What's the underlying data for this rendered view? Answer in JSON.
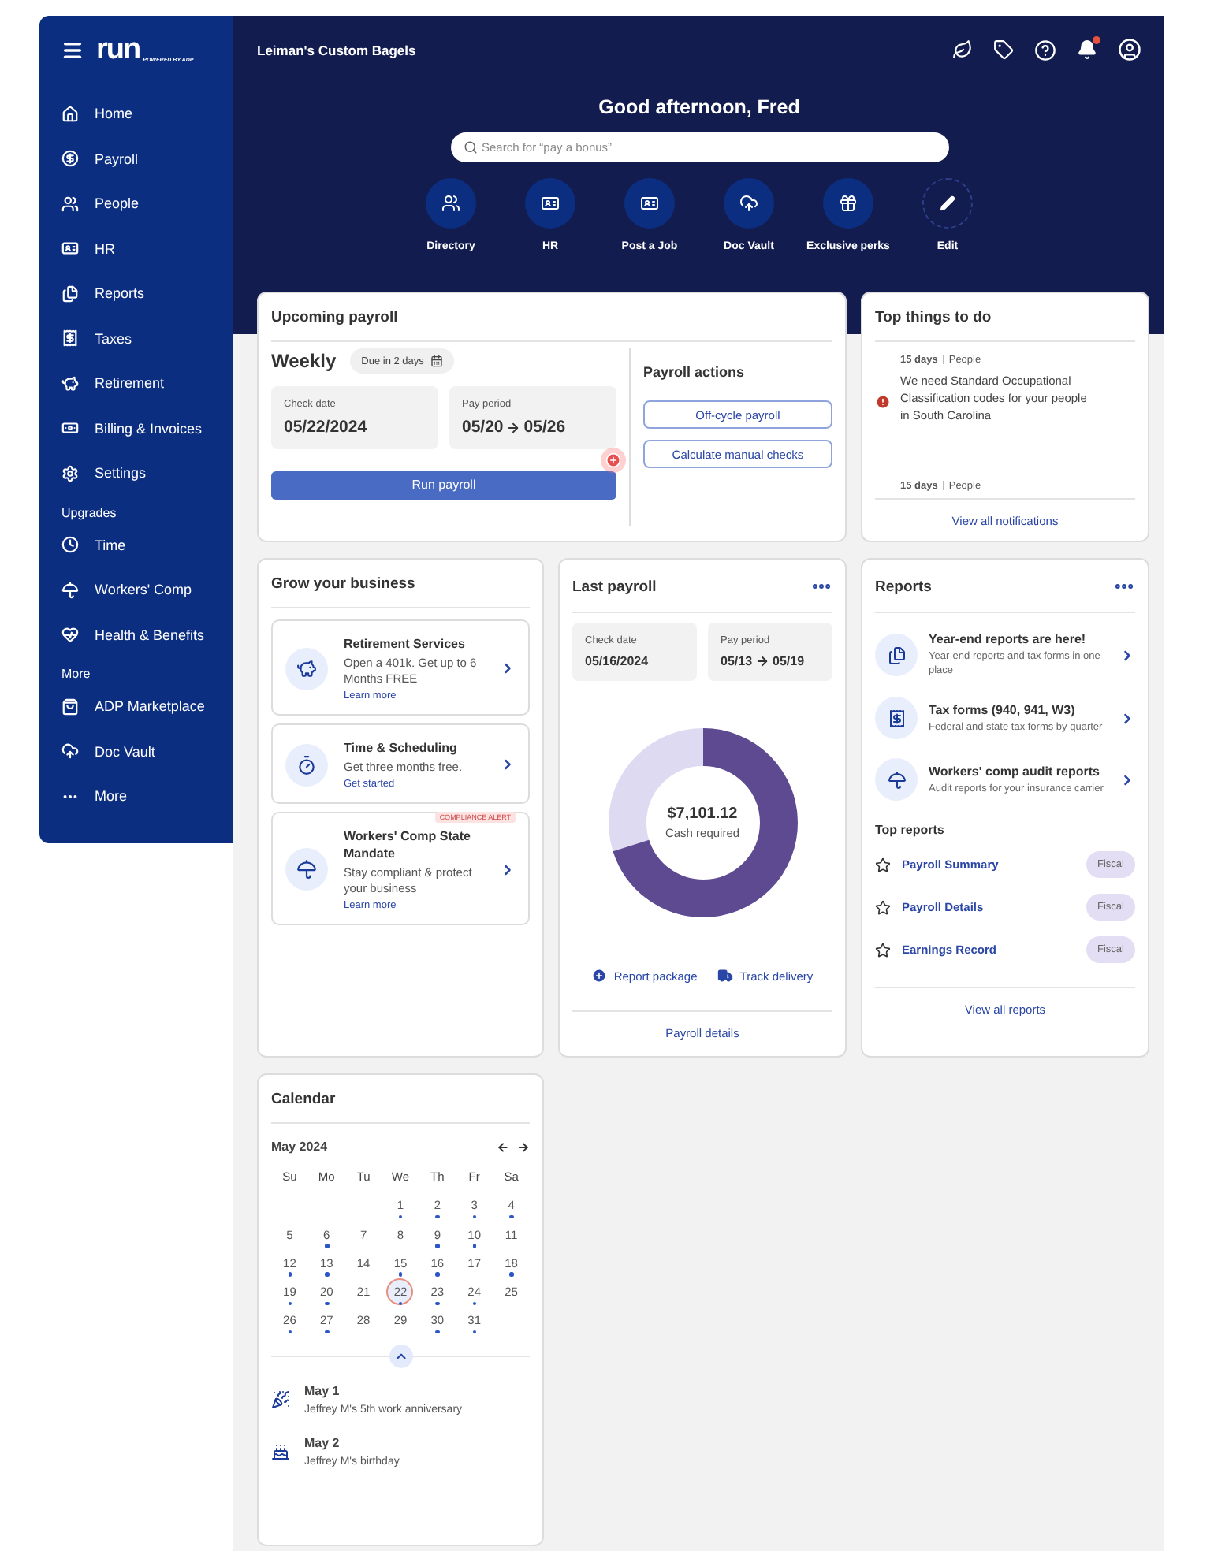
{
  "sidebar": {
    "logo": {
      "name": "run",
      "tagline": "POWERED BY ADP"
    },
    "sections": [
      {
        "items": [
          {
            "label": "Home"
          },
          {
            "label": "Payroll"
          },
          {
            "label": "People"
          },
          {
            "label": "HR"
          },
          {
            "label": "Reports"
          },
          {
            "label": "Taxes"
          },
          {
            "label": "Retirement"
          },
          {
            "label": "Billing & Invoices"
          },
          {
            "label": "Settings"
          }
        ]
      },
      {
        "heading": "Upgrades",
        "items": [
          {
            "label": "Time"
          },
          {
            "label": "Workers' Comp"
          },
          {
            "label": "Health & Benefits"
          }
        ]
      },
      {
        "heading": "More",
        "items": [
          {
            "label": "ADP Marketplace"
          },
          {
            "label": "Doc Vault"
          },
          {
            "label": "More"
          }
        ]
      }
    ]
  },
  "header": {
    "company": "Leiman's Custom Bagels",
    "bell_badge": true,
    "greeting": "Good afternoon, Fred",
    "search": {
      "placeholder": "Search for “pay a bonus”"
    },
    "quick_actions": [
      {
        "label": "Directory",
        "kind": "shortcut"
      },
      {
        "label": "HR",
        "kind": "shortcut"
      },
      {
        "label": "Post a Job",
        "kind": "shortcut"
      },
      {
        "label": "Doc Vault",
        "kind": "shortcut"
      },
      {
        "label": "Exclusive perks",
        "kind": "shortcut"
      },
      {
        "label": "Edit",
        "kind": "edit"
      }
    ]
  },
  "upcoming_payroll": {
    "title": "Upcoming payroll",
    "frequency": "Weekly",
    "due": "Due in 2 days",
    "check_date": {
      "label": "Check date",
      "value": "05/22/2024"
    },
    "pay_period": {
      "label": "Pay period",
      "start": "05/20",
      "end": "05/26"
    },
    "run_button": "Run payroll",
    "add_badge": true,
    "actions_title": "Payroll actions",
    "actions": [
      "Off-cycle payroll",
      "Calculate manual checks"
    ]
  },
  "top_things": {
    "title": "Top things to do",
    "items": [
      {
        "days": "15 days",
        "category": "People",
        "message": "We need Standard Occupational Classification codes for your people in South Carolina",
        "urgent": true
      },
      {
        "days": "15 days",
        "category": "People",
        "urgent": false
      }
    ],
    "link": "View all notifications"
  },
  "grow": {
    "title": "Grow your business",
    "offers": [
      {
        "title": "Retirement Services",
        "text": "Open a 401k. Get up to 6 Months FREE",
        "link": "Learn more"
      },
      {
        "title": "Time & Scheduling",
        "text": "Get three months free.",
        "link": "Get started"
      },
      {
        "title": "Workers' Comp State Mandate",
        "text": "Stay compliant & protect your business",
        "link": "Learn more",
        "badge": "COMPLIANCE ALERT"
      }
    ]
  },
  "last_payroll": {
    "title": "Last payroll",
    "check_date": {
      "label": "Check date",
      "value": "05/16/2024"
    },
    "pay_period": {
      "label": "Pay period",
      "start": "05/13",
      "end": "05/19"
    },
    "amount": "$7,101.12",
    "amount_label": "Cash required",
    "links": [
      "Report package",
      "Track delivery"
    ],
    "footer_link": "Payroll details"
  },
  "reports": {
    "title": "Reports",
    "features": [
      {
        "title": "Year-end reports are here!",
        "text": "Year-end reports and tax forms in one place"
      },
      {
        "title": "Tax forms (940, 941, W3)",
        "text": "Federal and state tax forms by quarter"
      },
      {
        "title": "Workers' comp audit reports",
        "text": "Audit reports for your insurance carrier"
      }
    ],
    "top_title": "Top reports",
    "top": [
      {
        "name": "Payroll Summary",
        "tag": "Fiscal",
        "starred": false
      },
      {
        "name": "Payroll Details",
        "tag": "Fiscal",
        "starred": false
      },
      {
        "name": "Earnings Record",
        "tag": "Fiscal",
        "starred": false
      }
    ],
    "footer_link": "View all reports"
  },
  "calendar": {
    "title": "Calendar",
    "month": "May 2024",
    "weekdays": [
      "Su",
      "Mo",
      "Tu",
      "We",
      "Th",
      "Fr",
      "Sa"
    ],
    "weeks": [
      [
        {
          "day": "1",
          "event": true,
          "selected": false
        },
        {
          "day": "2",
          "event": true,
          "selected": false
        },
        {
          "day": "3",
          "event": true,
          "selected": false
        },
        {
          "day": "4",
          "event": true,
          "selected": false
        }
      ],
      [
        {
          "day": "5",
          "event": false,
          "selected": false
        },
        {
          "day": "6",
          "event": true,
          "selected": false
        },
        {
          "day": "7",
          "event": false,
          "selected": false
        },
        {
          "day": "8",
          "event": false,
          "selected": false
        },
        {
          "day": "9",
          "event": true,
          "selected": false
        },
        {
          "day": "10",
          "event": true,
          "selected": false
        },
        {
          "day": "11",
          "event": false,
          "selected": false
        }
      ],
      [
        {
          "day": "12",
          "event": true,
          "selected": false
        },
        {
          "day": "13",
          "event": true,
          "selected": false
        },
        {
          "day": "14",
          "event": false,
          "selected": false
        },
        {
          "day": "15",
          "event": true,
          "selected": false
        },
        {
          "day": "16",
          "event": true,
          "selected": false
        },
        {
          "day": "17",
          "event": false,
          "selected": false
        },
        {
          "day": "18",
          "event": true,
          "selected": false
        }
      ],
      [
        {
          "day": "19",
          "event": true,
          "selected": false
        },
        {
          "day": "20",
          "event": true,
          "selected": false
        },
        {
          "day": "21",
          "event": false,
          "selected": false
        },
        {
          "day": "22",
          "event": true,
          "selected": true
        },
        {
          "day": "23",
          "event": true,
          "selected": false
        },
        {
          "day": "24",
          "event": true,
          "selected": false
        },
        {
          "day": "25",
          "event": false,
          "selected": false
        }
      ],
      [
        {
          "day": "26",
          "event": true,
          "selected": false
        },
        {
          "day": "27",
          "event": true,
          "selected": false
        },
        {
          "day": "28",
          "event": false,
          "selected": false
        },
        {
          "day": "29",
          "event": false,
          "selected": false
        },
        {
          "day": "30",
          "event": true,
          "selected": false
        },
        {
          "day": "31",
          "event": true,
          "selected": false
        }
      ]
    ],
    "events": [
      {
        "date": "May 1",
        "text": "Jeffrey M's 5th work anniversary",
        "kind": "anniversary"
      },
      {
        "date": "May 2",
        "text": "Jeffrey M's birthday",
        "kind": "birthday"
      }
    ]
  }
}
